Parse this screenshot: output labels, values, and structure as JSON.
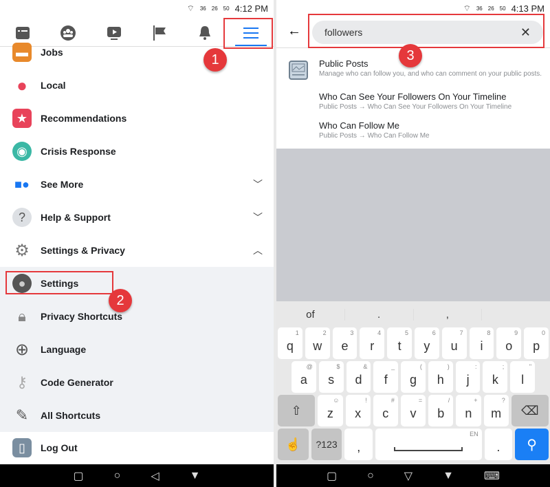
{
  "left": {
    "status": {
      "time": "4:12 PM",
      "battery": "50",
      "net1": "36",
      "net2": "26"
    },
    "tabs": [
      {
        "icon": "news-feed-icon"
      },
      {
        "icon": "groups-icon"
      },
      {
        "icon": "watch-icon"
      },
      {
        "icon": "pages-flag-icon"
      },
      {
        "icon": "bell-icon"
      },
      {
        "icon": "menu-icon",
        "active": true
      }
    ],
    "items": [
      {
        "label": "Jobs",
        "icon": "briefcase-icon"
      },
      {
        "label": "Local",
        "icon": "location-pin-icon"
      },
      {
        "label": "Recommendations",
        "icon": "star-icon"
      },
      {
        "label": "Crisis Response",
        "icon": "crisis-icon"
      },
      {
        "label": "See More",
        "icon": "shapes-icon",
        "chevron": "down"
      },
      {
        "label": "Help & Support",
        "icon": "question-icon",
        "chevron": "down"
      },
      {
        "label": "Settings & Privacy",
        "icon": "gear-icon",
        "chevron": "up"
      },
      {
        "label": "Settings",
        "icon": "user-icon"
      },
      {
        "label": "Privacy Shortcuts",
        "icon": "lock-icon"
      },
      {
        "label": "Language",
        "icon": "globe-icon"
      },
      {
        "label": "Code Generator",
        "icon": "key-icon"
      },
      {
        "label": "All Shortcuts",
        "icon": "pencil-icon"
      },
      {
        "label": "Log Out",
        "icon": "door-icon"
      }
    ],
    "annotations": [
      "1",
      "2"
    ]
  },
  "right": {
    "status": {
      "time": "4:13 PM",
      "battery": "50",
      "net1": "36",
      "net2": "26"
    },
    "search": {
      "value": "followers"
    },
    "results": [
      {
        "title": "Public Posts",
        "subtitle": "Manage who can follow you, and who can comment on your public posts."
      },
      {
        "title": "Who Can See Your Followers On Your Timeline",
        "subtitle": "Public Posts → Who Can See Your Followers On Your Timeline"
      },
      {
        "title": "Who Can Follow Me",
        "subtitle": "Public Posts → Who Can Follow Me"
      }
    ],
    "annotation": "3",
    "keyboard": {
      "suggestions": [
        "of",
        ".",
        ","
      ],
      "row1": [
        [
          "q",
          "1"
        ],
        [
          "w",
          "2"
        ],
        [
          "e",
          "3"
        ],
        [
          "r",
          "4"
        ],
        [
          "t",
          "5"
        ],
        [
          "y",
          "6"
        ],
        [
          "u",
          "7"
        ],
        [
          "i",
          "8"
        ],
        [
          "o",
          "9"
        ],
        [
          "p",
          "0"
        ]
      ],
      "row2": [
        [
          "a",
          "@"
        ],
        [
          "s",
          "$"
        ],
        [
          "d",
          "&"
        ],
        [
          "f",
          "_"
        ],
        [
          "g",
          "("
        ],
        [
          "h",
          ")"
        ],
        [
          "j",
          ":"
        ],
        [
          "k",
          ";"
        ],
        [
          "l",
          "\""
        ]
      ],
      "row3": [
        [
          "z",
          "☺"
        ],
        [
          "x",
          "!"
        ],
        [
          "c",
          "#"
        ],
        [
          "v",
          "="
        ],
        [
          "b",
          "/"
        ],
        [
          "n",
          "+"
        ],
        [
          "m",
          "?"
        ]
      ],
      "sym": "?123",
      "comma": ",",
      "period": ".",
      "lang": "EN"
    }
  },
  "colors": {
    "accent": "#1877f2",
    "annotation": "#e5383b",
    "search_key": "#1a7ff5"
  }
}
